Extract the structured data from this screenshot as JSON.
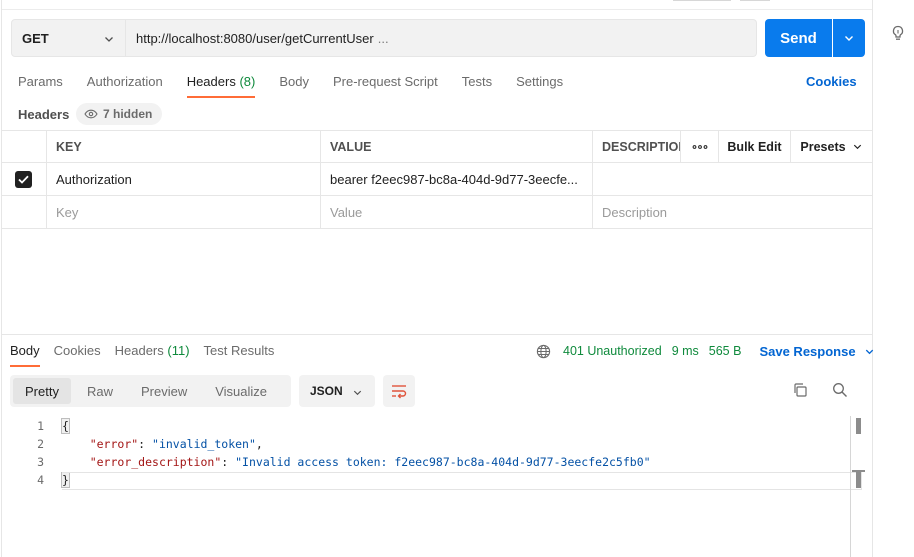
{
  "request": {
    "method": "GET",
    "url": "http://localhost:8080/user/getCurrentUser",
    "url_ellipsis": "...",
    "send_label": "Send"
  },
  "request_tabs": [
    {
      "label": "Params",
      "count": ""
    },
    {
      "label": "Authorization",
      "count": ""
    },
    {
      "label": "Headers",
      "count": "(8)"
    },
    {
      "label": "Body",
      "count": ""
    },
    {
      "label": "Pre-request Script",
      "count": ""
    },
    {
      "label": "Tests",
      "count": ""
    },
    {
      "label": "Settings",
      "count": ""
    }
  ],
  "active_request_tab": "Headers",
  "cookies_label": "Cookies",
  "headers_section": {
    "title": "Headers",
    "hidden_label": "7 hidden"
  },
  "headers_table": {
    "columns": {
      "key": "KEY",
      "value": "VALUE",
      "description": "DESCRIPTION"
    },
    "actions": {
      "bulk_edit": "Bulk Edit",
      "presets": "Presets"
    },
    "rows": [
      {
        "checked": true,
        "key": "Authorization",
        "value": "bearer f2eec987-bc8a-404d-9d77-3eecfe...",
        "description": ""
      }
    ],
    "placeholder": {
      "key": "Key",
      "value": "Value",
      "description": "Description"
    }
  },
  "response_tabs": [
    {
      "label": "Body",
      "count": ""
    },
    {
      "label": "Cookies",
      "count": ""
    },
    {
      "label": "Headers",
      "count": "(11)"
    },
    {
      "label": "Test Results",
      "count": ""
    }
  ],
  "active_response_tab": "Body",
  "response_meta": {
    "status": "401 Unauthorized",
    "time": "9 ms",
    "size": "565 B",
    "save_label": "Save Response"
  },
  "body_views": [
    "Pretty",
    "Raw",
    "Preview",
    "Visualize"
  ],
  "active_body_view": "Pretty",
  "body_format": "JSON",
  "response_body": {
    "line_numbers": [
      "1",
      "2",
      "3",
      "4"
    ],
    "open_brace": "{",
    "close_brace": "}",
    "fields": [
      {
        "key": "\"error\"",
        "value": "\"invalid_token\"",
        "trailing": ","
      },
      {
        "key": "\"error_description\"",
        "value": "\"Invalid access token: f2eec987-bc8a-404d-9d77-3eecfe2c5fb0\"",
        "trailing": ""
      }
    ]
  },
  "colors": {
    "accent_tab": "#ff6c37",
    "send_button": "#097bed",
    "link_blue": "#0265d2",
    "status_green": "#0f8a3c",
    "json_key": "#a31515",
    "json_string": "#0451a5"
  },
  "icons": [
    "chevron-down-icon",
    "lightbulb-icon",
    "eye-icon",
    "checkmark-icon",
    "more-dots-icon",
    "globe-icon",
    "wrap-lines-icon",
    "copy-icon",
    "search-icon"
  ]
}
